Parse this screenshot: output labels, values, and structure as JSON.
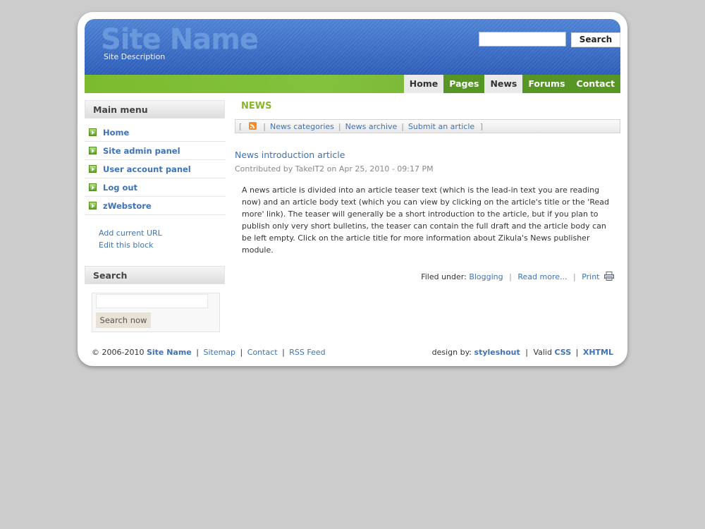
{
  "header": {
    "site_name": "Site Name",
    "site_description": "Site Description",
    "search_button": "Search"
  },
  "nav": {
    "items": [
      "Home",
      "Pages",
      "News",
      "Forums",
      "Contact"
    ]
  },
  "sidebar": {
    "main_menu_title": "Main menu",
    "menu_items": [
      "Home",
      "Site admin panel",
      "User account panel",
      "Log out",
      "zWebstore"
    ],
    "add_current_url": "Add current URL",
    "edit_block": "Edit this block",
    "search_title": "Search",
    "search_button": "Search now"
  },
  "main": {
    "section_title": "NEWS",
    "subnav": {
      "open_bracket": "[",
      "close_bracket": "]",
      "links": [
        "News categories",
        "News archive",
        "Submit an article"
      ]
    },
    "article": {
      "title": "News introduction article",
      "meta": "Contributed by TakeIT2 on Apr 25, 2010 - 09:17 PM",
      "body": "A news article is divided into an article teaser text (which is the lead-in text you are reading now) and an article body text (which you can view by clicking on the article's title or the 'Read more' link). The teaser will generally be a short introduction to the article, but if you plan to publish only very short bulletins, the teaser can contain the full draft and the article body can be left empty. Click on the article title for more information about Zikula's News publisher module.",
      "filed_under_label": "Filed under:",
      "category": "Blogging",
      "read_more": "Read more...",
      "print": "Print"
    }
  },
  "footer": {
    "copyright": "© 2006-2010",
    "site_name": "Site Name",
    "links": [
      "Sitemap",
      "Contact",
      "RSS Feed"
    ],
    "design_by_label": "design by:",
    "designer": "styleshout",
    "valid_label": "Valid",
    "css": "CSS",
    "xhtml": "XHTML"
  },
  "colors": {
    "header_blue": "#3a6fc8",
    "nav_green": "#7cbb2e",
    "nav_active": "#eaeaea",
    "link_blue": "#3f72b6",
    "news_green": "#8bb52e"
  }
}
